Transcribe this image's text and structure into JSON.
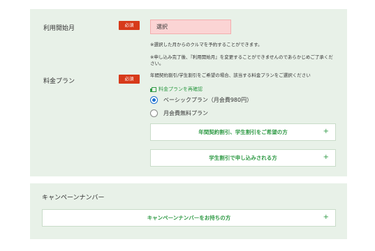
{
  "form": {
    "start_month": {
      "label": "利用開始月",
      "required_badge": "必須",
      "select_value": "選択",
      "note1": "※選択した月からのクルマを予約することができます。",
      "note2": "※申し込み完了後、『利用開始月』を変更することができませんのであらかじめご了承ください。"
    },
    "plan": {
      "label": "料金プラン",
      "required_badge": "必須",
      "note": "年間契約割引/学生割引をご希望の場合、該当する料金プランをご選択ください",
      "recheck_link": "料金プランを再確認",
      "options": [
        {
          "label": "ベーシックプラン（月会費980円）",
          "checked": true
        },
        {
          "label": "月会費無料プラン",
          "checked": false
        }
      ],
      "accordions": [
        {
          "label": "年間契約割引、学生割引をご希望の方",
          "icon": "+"
        },
        {
          "label": "学生割引で申し込みされる方",
          "icon": "+"
        }
      ]
    }
  },
  "campaign": {
    "label": "キャンペーンナンバー",
    "accordion": {
      "label": "キャンペーンナンバーをお持ちの方",
      "icon": "+"
    }
  },
  "colors": {
    "panel_bg": "#e8f1e8",
    "badge_red": "#d73a1a",
    "accent_green": "#2f9a45",
    "select_pink": "#fbd4d4",
    "radio_blue": "#1a6fd0"
  }
}
